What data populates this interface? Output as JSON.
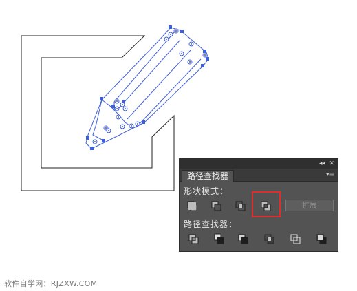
{
  "panel": {
    "tab_label": "路径查找器",
    "collapse_glyph": "◂◂",
    "close_glyph": "✕",
    "menu_glyph": "▾≡",
    "shape_modes_label": "形状模式：",
    "pathfinders_label": "路径查找器：",
    "expand_label": "扩展",
    "shape_mode_buttons": [
      "unite-icon",
      "minus-front-icon",
      "intersect-icon",
      "exclude-icon"
    ],
    "pathfinder_buttons": [
      "divide-icon",
      "trim-icon",
      "merge-icon",
      "crop-icon",
      "outline-icon",
      "minus-back-icon"
    ],
    "highlighted_button": "exclude-icon"
  },
  "colors": {
    "selection_blue": "#3f5fd8",
    "highlight_red": "#e22b2b",
    "panel_bg": "#535353"
  },
  "watermark": "软件自学网：RJZXW.COM"
}
